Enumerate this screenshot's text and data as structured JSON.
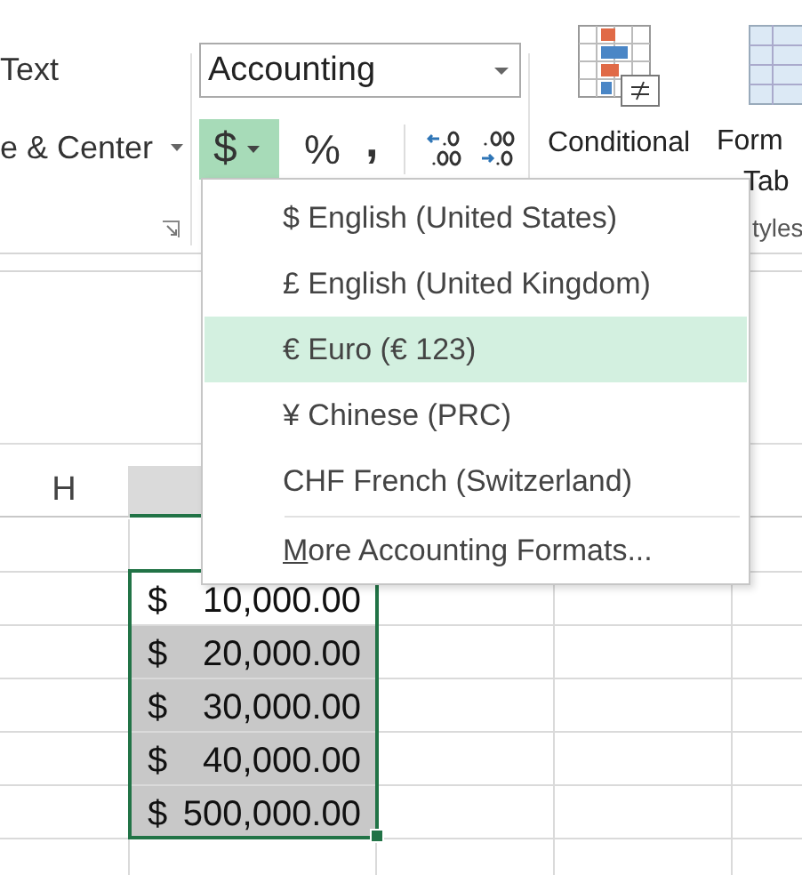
{
  "ribbon": {
    "alignment_group": {
      "wrap_text_label": "Text",
      "merge_label": "e & Center"
    },
    "number_group": {
      "format_box": {
        "value": "Accounting"
      },
      "currency_button": {
        "symbol": "$",
        "pressed": true
      },
      "percent_button": "%",
      "comma_button": ","
    },
    "styles_group": {
      "conditional_formatting_label": "Conditional",
      "format_table_labels": [
        "Form",
        "Tab"
      ],
      "group_label": "tyles"
    }
  },
  "currency_menu": {
    "items": [
      {
        "label": "$ English (United States)",
        "selected": false
      },
      {
        "label": "£ English (United Kingdom)",
        "selected": false
      },
      {
        "label": "€ Euro (€ 123)",
        "selected": true
      },
      {
        "label": "¥ Chinese (PRC)",
        "selected": false
      },
      {
        "label": "CHF French (Switzerland)",
        "selected": false
      }
    ],
    "more_formats": {
      "label": "More Accounting Formats...",
      "access_key_underlined": true
    }
  },
  "sheet": {
    "columns": [
      {
        "label": "H",
        "selected": false
      },
      {
        "selected": true
      }
    ],
    "cells": [
      {
        "symbol": "$",
        "amount": "10,000.00",
        "active": true
      },
      {
        "symbol": "$",
        "amount": "20,000.00",
        "active": false
      },
      {
        "symbol": "$",
        "amount": "30,000.00",
        "active": false
      },
      {
        "symbol": "$",
        "amount": "40,000.00",
        "active": false
      },
      {
        "symbol": "$",
        "amount": "500,000.00",
        "active": false
      }
    ]
  }
}
